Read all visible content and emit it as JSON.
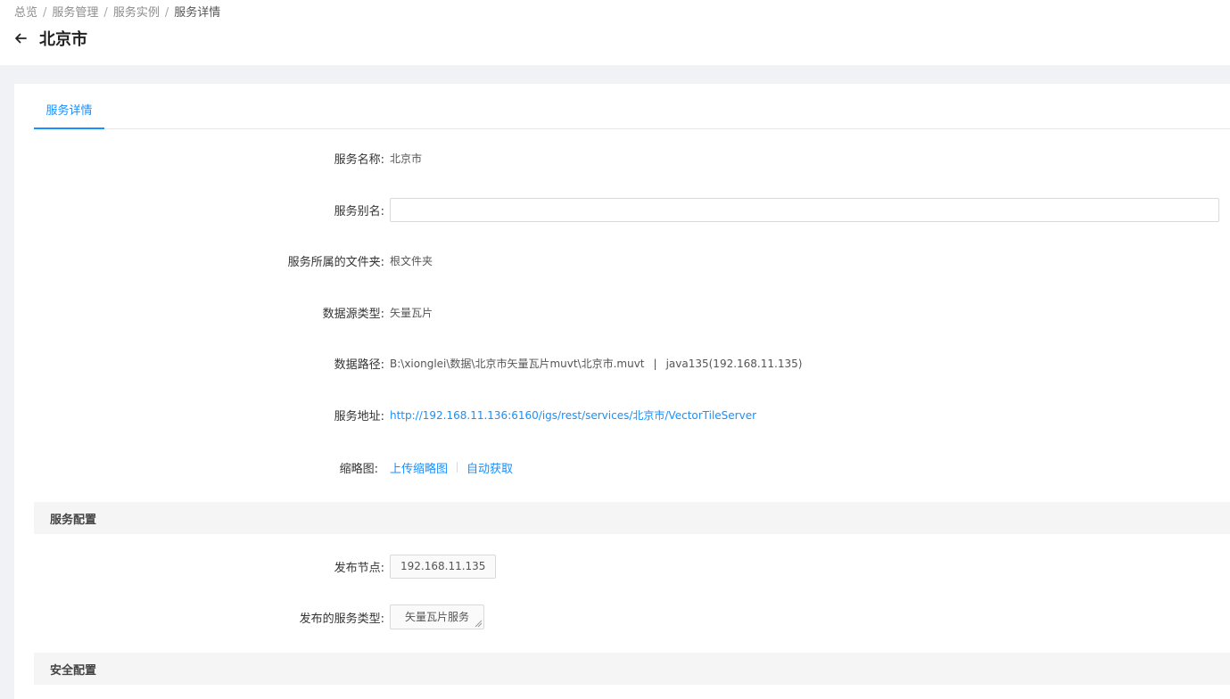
{
  "breadcrumb": {
    "items": [
      "总览",
      "服务管理",
      "服务实例"
    ],
    "current": "服务详情",
    "separator": "/"
  },
  "header": {
    "title": "北京市"
  },
  "tabs": [
    {
      "label": "服务详情",
      "active": true
    }
  ],
  "details": {
    "service_name": {
      "label": "服务名称:",
      "value": "北京市"
    },
    "service_alias": {
      "label": "服务别名:",
      "value": "",
      "placeholder": ""
    },
    "folder": {
      "label": "服务所属的文件夹:",
      "value": "根文件夹"
    },
    "datasource_type": {
      "label": "数据源类型:",
      "value": "矢量瓦片"
    },
    "data_path": {
      "label": "数据路径:",
      "path": "B:\\xionglei\\数据\\北京市矢量瓦片muvt\\北京市.muvt",
      "pipe": "|",
      "node": "java135(192.168.11.135)"
    },
    "service_url": {
      "label": "服务地址:",
      "value": "http://192.168.11.136:6160/igs/rest/services/北京市/VectorTileServer"
    },
    "thumbnail": {
      "label": "缩略图:",
      "upload": "上传缩略图",
      "auto": "自动获取"
    }
  },
  "service_config": {
    "title": "服务配置",
    "node": {
      "label": "发布节点:",
      "value": "192.168.11.135"
    },
    "service_type": {
      "label": "发布的服务类型:",
      "value": "矢量瓦片服务"
    }
  },
  "security_config": {
    "title": "安全配置"
  },
  "colors": {
    "accent": "#1890ff",
    "background": "#f0f2f5",
    "section_bg": "#f5f5f5"
  }
}
